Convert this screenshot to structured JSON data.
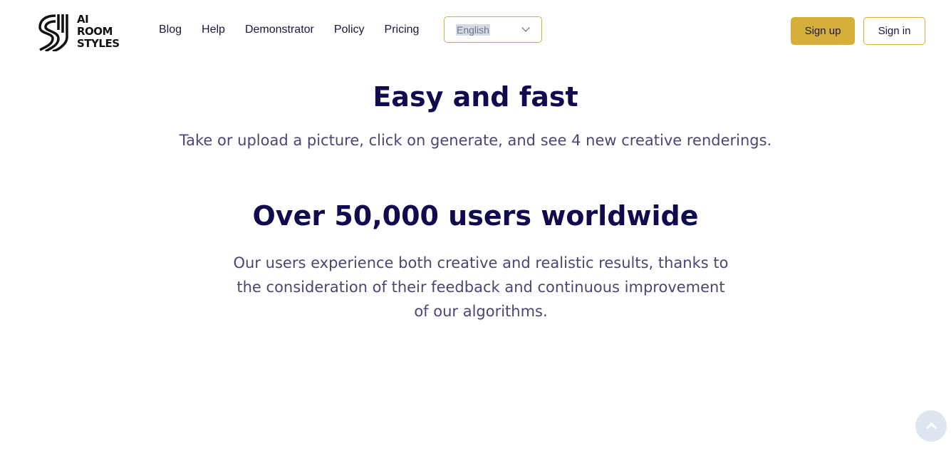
{
  "header": {
    "logo_text": [
      "AI",
      "ROOM",
      "STYLES"
    ],
    "nav": [
      "Blog",
      "Help",
      "Demonstrator",
      "Policy",
      "Pricing"
    ],
    "language": "English",
    "signup": "Sign up",
    "signin": "Sign in"
  },
  "main": {
    "section1": {
      "title": "Easy and fast",
      "text": "Take or upload a picture, click on generate, and see 4 new creative renderings."
    },
    "section2": {
      "title": "Over 50,000 users worldwide",
      "text": "Our users experience both creative and realistic results, thanks to the consideration of their feedback and continuous improvement of our algorithms."
    }
  },
  "colors": {
    "accent": "#d6ae3a",
    "heading": "#100a4f",
    "text": "#4a4676"
  },
  "icons": {
    "scroll_top": "chevron-up-icon",
    "language": "chevron-down-icon"
  }
}
